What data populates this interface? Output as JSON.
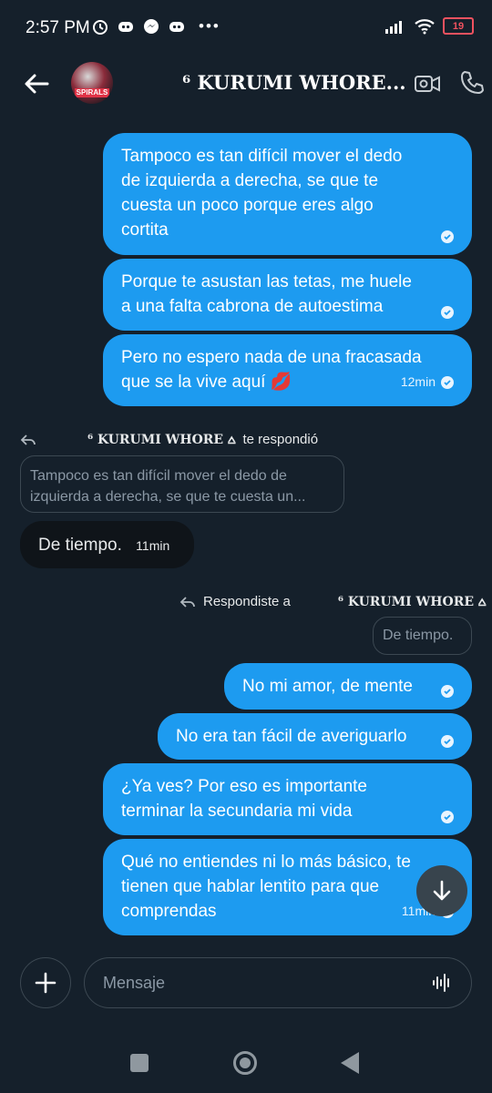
{
  "status": {
    "time": "2:57 PM",
    "battery": "19",
    "left_icons": [
      "alarm-icon",
      "discord-icon",
      "messenger-icon",
      "discord-icon",
      "more-icon"
    ],
    "right_icons": [
      "signal-icon",
      "wifi-icon",
      "battery-icon"
    ]
  },
  "header": {
    "title": "⁶ KURUMI WHORE...",
    "avatar_label": "SPIRALS"
  },
  "messages": [
    {
      "text": "Tampoco es tan difícil mover el dedo\nde izquierda a derecha, se que te\ncuesta un poco porque eres algo\ncortita",
      "time": ""
    },
    {
      "text": "Porque te asustan las tetas, me huele\na una falta cabrona de autoestima",
      "time": ""
    },
    {
      "text": "Pero no espero nada de una fracasada\nque se la vive aquí 💋",
      "time": "12min"
    }
  ],
  "incoming_reply": {
    "label_name": "⁶ KURUMI WHORE ⩟",
    "label_suffix": "te respondió",
    "quote": "Tampoco es tan difícil mover el dedo de\nizquierda a derecha, se que te cuesta un...",
    "text": "De tiempo.",
    "time": "11min"
  },
  "outgoing_reply": {
    "label_prefix": "Respondiste a",
    "label_name": "⁶ KURUMI WHORE ⩟",
    "quote": "De tiempo."
  },
  "messages2": [
    {
      "text": "No mi amor, de mente",
      "time": ""
    },
    {
      "text": "No era tan fácil de averiguarlo",
      "time": ""
    },
    {
      "text": "¿Ya ves? Por eso es importante\nterminar la secundaria mi vida",
      "time": ""
    },
    {
      "text": "Qué no entiendes ni lo más básico, te\ntienen que hablar lentito para que\ncomprendas",
      "time": "11min"
    }
  ],
  "composer": {
    "placeholder": "Mensaje"
  },
  "colors": {
    "background": "#15202b",
    "outgoing_bubble": "#1d9bf0",
    "incoming_bubble": "#0f1419"
  }
}
